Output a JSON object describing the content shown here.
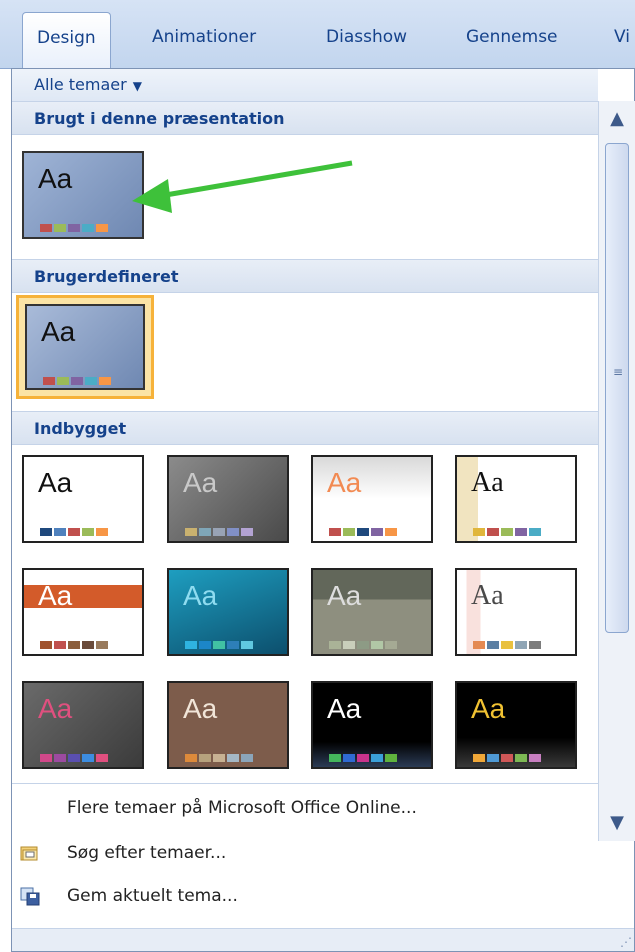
{
  "tabs": [
    {
      "label": "Design",
      "active": true
    },
    {
      "label": "Animationer",
      "active": false
    },
    {
      "label": "Diasshow",
      "active": false
    },
    {
      "label": "Gennemse",
      "active": false
    },
    {
      "label": "Vi",
      "active": false
    }
  ],
  "gallery": {
    "filter_label": "Alle temaer",
    "sections": {
      "used": "Brugt i denne præsentation",
      "custom": "Brugerdefineret",
      "builtin": "Indbygget"
    },
    "thumb_text": "Aa"
  },
  "menu": {
    "more_themes": "Flere temaer på Microsoft Office Online...",
    "browse_themes": "Søg efter temaer...",
    "save_theme": "Gem aktuelt tema..."
  },
  "colors": {
    "accent_border": "#f6b23a",
    "section_text": "#15428b",
    "arrow": "#3ec13a"
  },
  "icons": {
    "filter_caret": "caret-down-icon",
    "scroll_up": "scroll-up-icon",
    "scroll_down": "scroll-down-icon",
    "browse": "folder-search-icon",
    "save": "save-theme-icon",
    "annotation": "green-arrow"
  }
}
